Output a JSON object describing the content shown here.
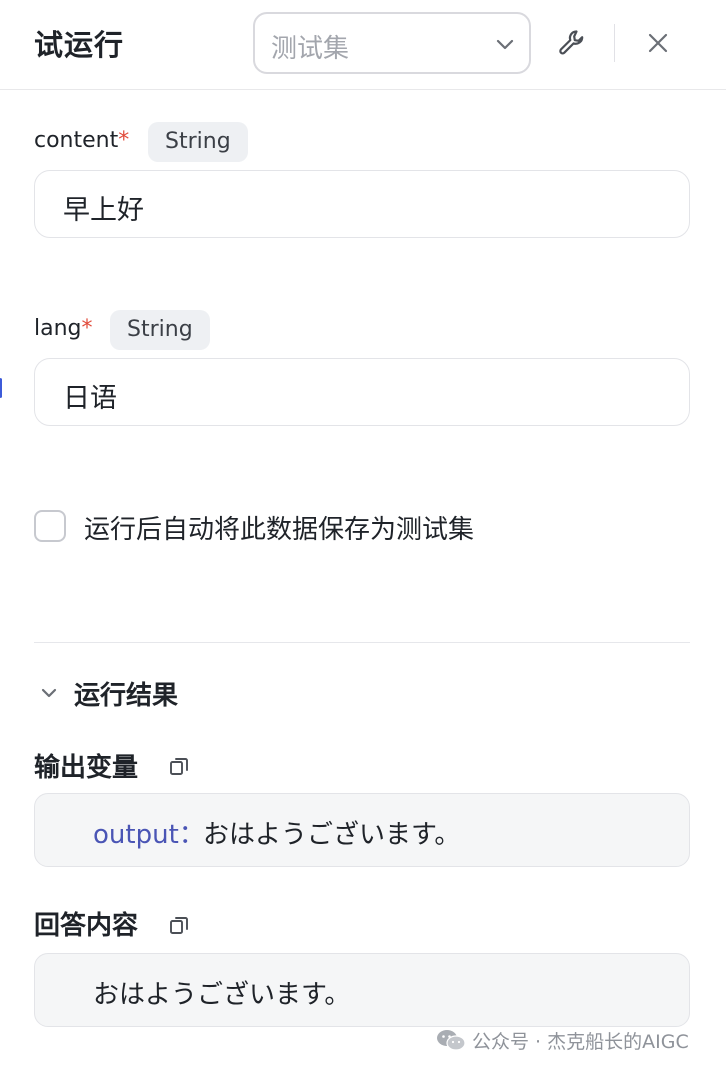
{
  "header": {
    "title": "试运行",
    "test_set_select": {
      "placeholder": "测试集"
    }
  },
  "fields": [
    {
      "name": "content",
      "required_mark": "*",
      "type": "String",
      "value": "早上好"
    },
    {
      "name": "lang",
      "required_mark": "*",
      "type": "String",
      "value": "日语"
    }
  ],
  "auto_save": {
    "label": "运行后自动将此数据保存为测试集",
    "checked": false
  },
  "result": {
    "section_title": "运行结果",
    "output_variables": {
      "label": "输出变量",
      "key": "output：",
      "value": "おはようございます。"
    },
    "answer_content": {
      "label": "回答内容",
      "value": "おはようございます。"
    }
  },
  "watermark": {
    "text": "公众号 · 杰克船长的AIGC"
  },
  "colors": {
    "accent": "#4a55b5",
    "required": "#e14b3b",
    "tag_bg": "#eef0f3",
    "output_bg": "#f5f6f7"
  }
}
